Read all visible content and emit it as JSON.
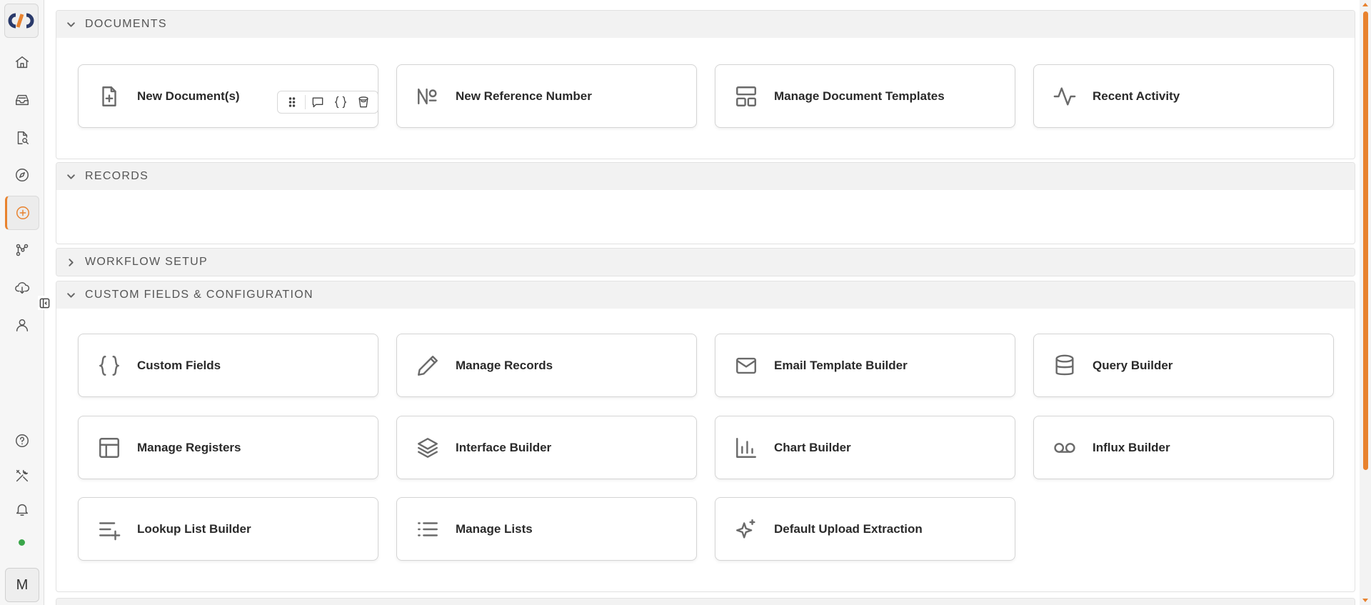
{
  "sidebar": {
    "nav": [
      {
        "name": "home",
        "icon": "home-icon"
      },
      {
        "name": "inbox",
        "icon": "inbox-icon"
      },
      {
        "name": "document-search",
        "icon": "file-search-icon"
      },
      {
        "name": "explore",
        "icon": "compass-icon"
      },
      {
        "name": "create",
        "icon": "plus-circle-icon",
        "active": true
      },
      {
        "name": "workflow",
        "icon": "nodes-icon"
      },
      {
        "name": "cloud",
        "icon": "cloud-download-icon"
      },
      {
        "name": "users",
        "icon": "user-icon"
      }
    ],
    "bottom": [
      {
        "name": "help",
        "icon": "help-circle-icon"
      },
      {
        "name": "tools",
        "icon": "tools-icon"
      },
      {
        "name": "notifications",
        "icon": "bell-icon"
      }
    ],
    "avatar_initial": "M",
    "status_color": "#3aa64a",
    "accent_color": "#e8822e"
  },
  "sections": {
    "documents": {
      "title": "DOCUMENTS",
      "expanded": true,
      "cards": [
        {
          "label": "New Document(s)",
          "icon": "file-plus-icon"
        },
        {
          "label": "New Reference Number",
          "icon": "numero-icon"
        },
        {
          "label": "Manage Document Templates",
          "icon": "layout-template-icon"
        },
        {
          "label": "Recent Activity",
          "icon": "activity-icon"
        }
      ]
    },
    "records": {
      "title": "RECORDS",
      "expanded": true,
      "cards": []
    },
    "workflow_setup": {
      "title": "WORKFLOW SETUP",
      "expanded": false
    },
    "custom_fields": {
      "title": "CUSTOM FIELDS & CONFIGURATION",
      "expanded": true,
      "cards": [
        {
          "label": "Custom Fields",
          "icon": "braces-icon"
        },
        {
          "label": "Manage Records",
          "icon": "pencil-icon"
        },
        {
          "label": "Email Template Builder",
          "icon": "mail-icon"
        },
        {
          "label": "Query Builder",
          "icon": "database-icon"
        },
        {
          "label": "Manage Registers",
          "icon": "table-icon"
        },
        {
          "label": "Interface Builder",
          "icon": "layers-icon"
        },
        {
          "label": "Chart Builder",
          "icon": "bar-chart-icon"
        },
        {
          "label": "Influx Builder",
          "icon": "voicemail-icon"
        },
        {
          "label": "Lookup List Builder",
          "icon": "list-plus-icon"
        },
        {
          "label": "Manage Lists",
          "icon": "list-icon"
        },
        {
          "label": "Default Upload Extraction",
          "icon": "sparkles-icon"
        }
      ]
    }
  }
}
